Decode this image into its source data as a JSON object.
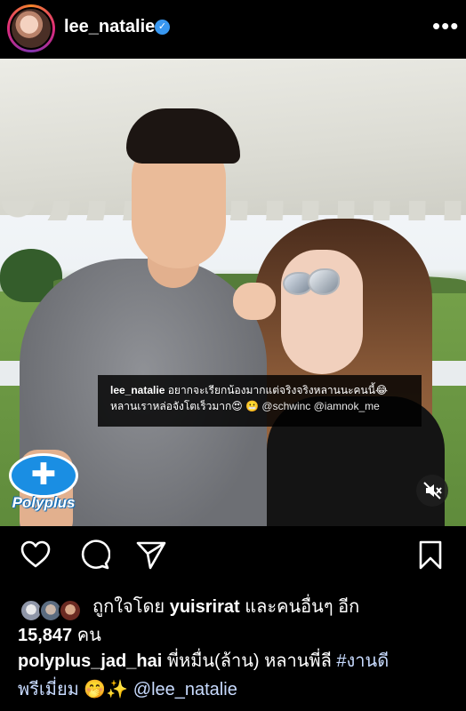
{
  "header": {
    "username": "lee_natalie",
    "verified_glyph": "✓",
    "more_glyph": "•••"
  },
  "photo": {
    "overlay_user": "lee_natalie",
    "overlay_line1": " อยากจะเรียกน้องมากแต่จริงจริงหลานนะคนนี้😂",
    "overlay_line2": "หลานเราหล่อจังโตเร็วมาก😍 😬 ",
    "overlay_mentions": "@schwinc @iamnok_me",
    "logo_text": "Polyplus",
    "icons": [
      "mute-icon"
    ]
  },
  "actions": {
    "icons": [
      "heart-icon",
      "comment-icon",
      "share-icon",
      "bookmark-icon"
    ]
  },
  "likes": {
    "prefix": "ถูกใจโดย ",
    "user": "yuisrirat",
    "suffix": " และคนอื่นๆ อีก",
    "count": "15,847",
    "unit": " คน"
  },
  "caption": {
    "user": "polyplus_jad_hai",
    "text": " พี่หมื่น(ล้าน) หลานพี่ลี ",
    "hashtag": "#งานดี",
    "line2": "พรีเมี่ยม 🤭✨ ",
    "mention": "@lee_natalie"
  },
  "colors": {
    "background": "#000000",
    "verified": "#3897f0",
    "link": "#c8dbff",
    "logo": "#1a8ee3"
  }
}
